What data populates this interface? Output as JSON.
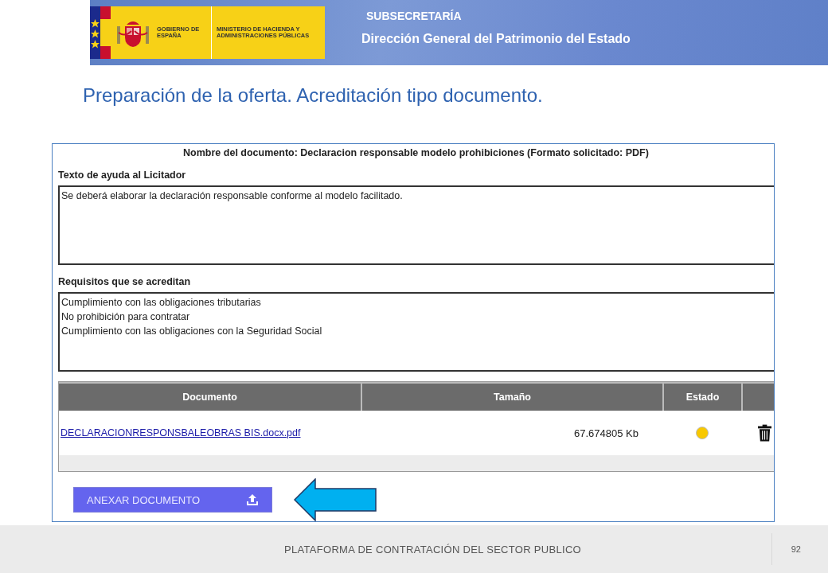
{
  "header": {
    "logo": {
      "government": "GOBIERNO DE ESPAÑA",
      "ministry": "MINISTERIO DE HACIENDA Y ADMINISTRACIONES PÚBLICAS"
    },
    "unit": "SUBSECRETARÍA",
    "directorate": "Dirección General del Patrimonio del Estado"
  },
  "title": "Preparación de la oferta. Acreditación tipo documento.",
  "form": {
    "document_name": "Nombre del documento: Declaracion responsable modelo prohibiciones (Formato solicitado: PDF)",
    "help_label": "Texto de ayuda al Licitador",
    "help_text": "Se deberá elaborar la declaración responsable conforme al modelo facilitado.",
    "requirements_label": "Requisitos que se acreditan",
    "requirements": [
      "Cumplimiento con las obligaciones tributarias",
      "No prohibición para contratar",
      "Cumplimiento con las obligaciones con la Seguridad Social"
    ],
    "table": {
      "columns": [
        "Documento",
        "Tamaño",
        "Estado"
      ],
      "rows": [
        {
          "document": "DECLARACIONRESPONSBALEOBRAS BIS.docx.pdf",
          "size": "67.674805 Kb",
          "color": "#f8c800"
        }
      ]
    },
    "attach_button": "ANEXAR DOCUMENTO"
  },
  "footer": {
    "text": "PLATAFORMA DE CONTRATACIÓN DEL SECTOR PUBLICO",
    "page": "92"
  }
}
